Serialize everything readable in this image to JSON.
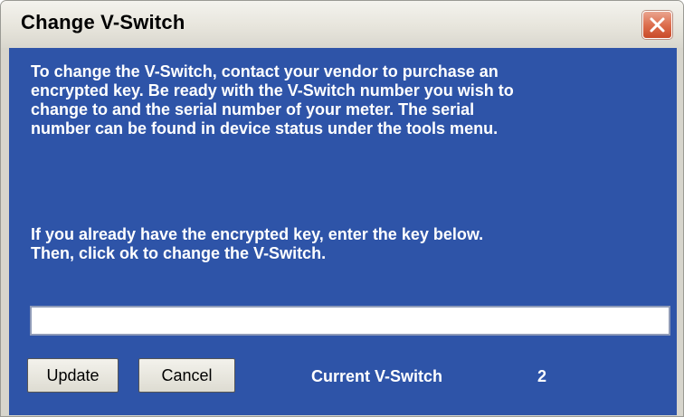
{
  "window": {
    "title": "Change V-Switch"
  },
  "icons": {
    "close": "close-icon"
  },
  "colors": {
    "dialog_background": "#2e54a8",
    "text": "#ffffff",
    "close_button": "#dd6f4f"
  },
  "dialog": {
    "instructions": "To change the V-Switch, contact your vendor to purchase an\nencrypted key.  Be ready with the V-Switch number you wish to\nchange to and the serial number of your meter.  The serial\nnumber can be found in device status under the tools menu.",
    "key_prompt": "If you already have the encrypted key, enter the key below.\nThen, click ok to change the V-Switch.",
    "key_input": {
      "value": "",
      "placeholder": ""
    },
    "update_label": "Update",
    "cancel_label": "Cancel",
    "current_vswitch_label": "Current V-Switch",
    "current_vswitch_value": "2"
  }
}
